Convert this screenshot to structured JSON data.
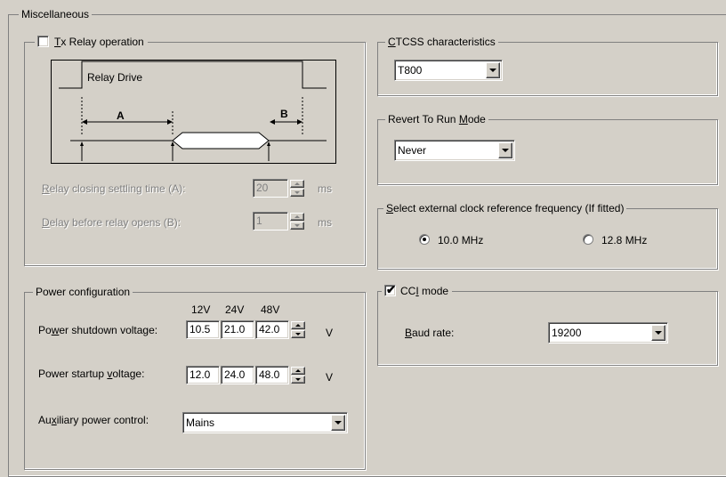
{
  "misc": {
    "title": "Miscellaneous"
  },
  "tx_relay": {
    "checkbox_label_key": "T",
    "checkbox_label_rest": "x Relay operation",
    "checked": false,
    "diagram": {
      "relay_drive_label": "Relay Drive",
      "label_a": "A",
      "label_b": "B"
    },
    "closing_key": "R",
    "closing_rest": "elay closing settling time (A):",
    "closing_value": "20",
    "closing_unit": "ms",
    "opens_key": "D",
    "opens_rest": "elay before relay opens (B):",
    "opens_value": "1",
    "opens_unit": "ms"
  },
  "power": {
    "title": "Power configuration",
    "col_12v": "12V",
    "col_24v": "24V",
    "col_48v": "48V",
    "shutdown_pre": "Po",
    "shutdown_key": "w",
    "shutdown_post": "er shutdown voltage:",
    "shutdown_values": [
      "10.5",
      "21.0",
      "42.0"
    ],
    "startup_pre": "Power startup ",
    "startup_key": "v",
    "startup_post": "oltage:",
    "startup_values": [
      "12.0",
      "24.0",
      "48.0"
    ],
    "unit": "V",
    "aux_pre": "Au",
    "aux_key": "x",
    "aux_post": "iliary power control:",
    "aux_value": "Mains"
  },
  "ctcss": {
    "title_key": "C",
    "title_rest": "TCSS characteristics",
    "value": "T800"
  },
  "revert": {
    "title_pre": "Revert To Run ",
    "title_key": "M",
    "title_post": "ode",
    "value": "Never"
  },
  "clock": {
    "title_key": "S",
    "title_rest": "elect external clock reference frequency (If fitted)",
    "option1": "10.0 MHz",
    "option2": "12.8 MHz",
    "selected": "10.0 MHz"
  },
  "cci": {
    "label_pre": "CC",
    "label_key": "I",
    "label_post": " mode",
    "checked": true,
    "baud_key": "B",
    "baud_rest": "aud rate:",
    "baud_value": "19200"
  }
}
